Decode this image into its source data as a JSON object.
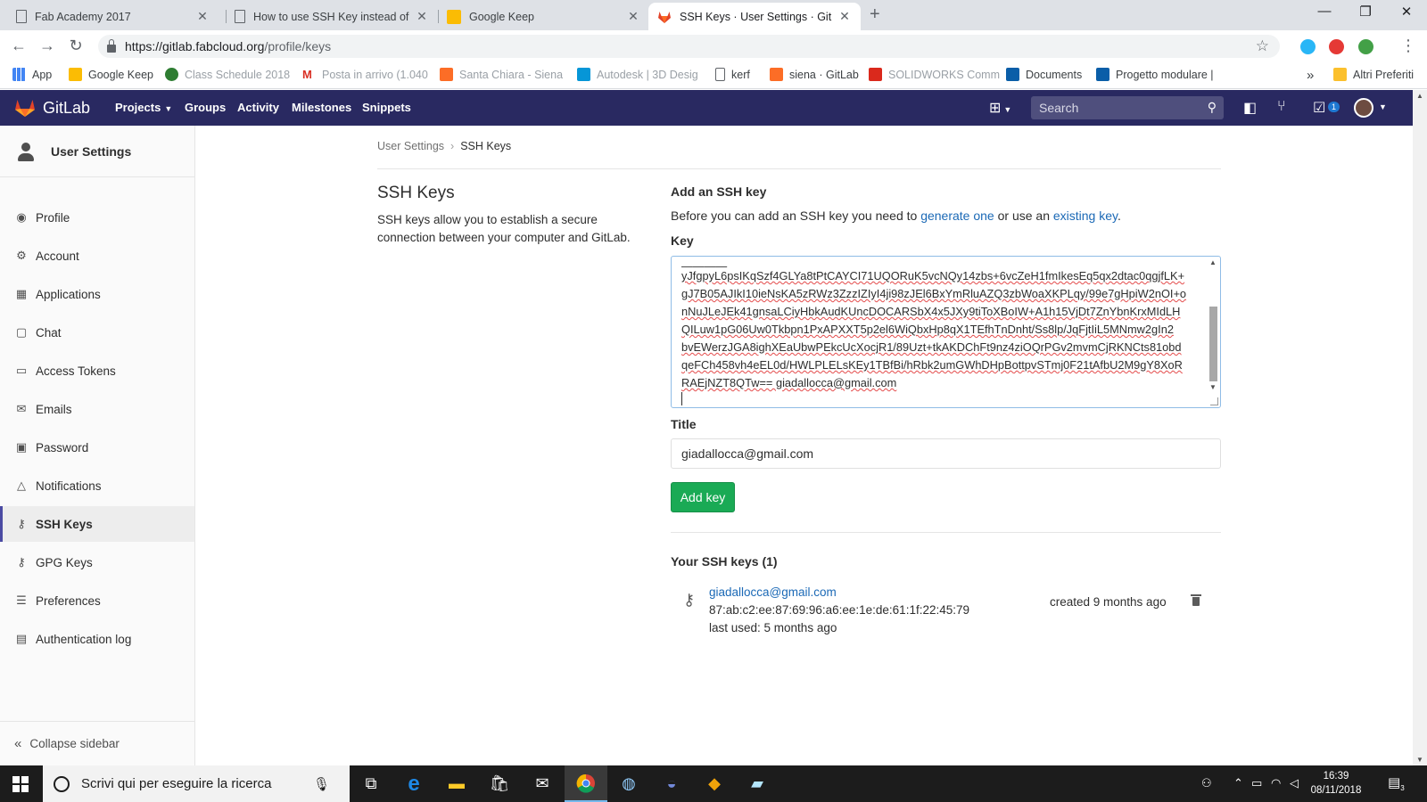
{
  "browser": {
    "tabs": [
      {
        "label": "Fab Academy 2017",
        "icon": "document-icon",
        "active": false
      },
      {
        "label": "How to use SSH Key instead of H",
        "icon": "document-icon",
        "active": false
      },
      {
        "label": "Google Keep",
        "icon": "keep-icon",
        "active": false
      },
      {
        "label": "SSH Keys · User Settings · GitLab",
        "icon": "gitlab-icon",
        "active": true
      }
    ],
    "new_tab": "+",
    "window_controls": {
      "minimize": "—",
      "restore": "❐",
      "close": "✕"
    },
    "url_host": "https://gitlab.fabcloud.org",
    "url_path": "/profile/keys",
    "bookmarks": [
      {
        "label": "App",
        "icon": "apps-icon"
      },
      {
        "label": "Google Keep",
        "icon": "keep-icon"
      },
      {
        "label": "Class Schedule 2018",
        "icon": "globe-icon"
      },
      {
        "label": "Posta in arrivo (1.040",
        "icon": "gmail-icon"
      },
      {
        "label": "Santa Chiara - Siena",
        "icon": "gitlab-icon"
      },
      {
        "label": "Autodesk | 3D Desig",
        "icon": "autodesk-icon"
      },
      {
        "label": "kerf",
        "icon": "document-icon"
      },
      {
        "label": "siena · GitLab",
        "icon": "gitlab-icon"
      },
      {
        "label": "SOLIDWORKS Comm",
        "icon": "solidworks-icon"
      },
      {
        "label": "Documents",
        "icon": "onshape-icon"
      },
      {
        "label": "Progetto modulare |",
        "icon": "onshape-icon"
      }
    ],
    "bookmarks_more": "»",
    "other_bookmarks": "Altri Preferiti"
  },
  "gitlab_nav": {
    "brand": "GitLab",
    "links": [
      "Projects",
      "Groups",
      "Activity",
      "Milestones",
      "Snippets"
    ],
    "search_placeholder": "Search",
    "todo_count": "1",
    "colors": {
      "nav_bg": "#292961",
      "brand_orange": "#fc6d26"
    }
  },
  "sidebar": {
    "title": "User Settings",
    "items": [
      {
        "label": "Profile",
        "icon": "profile-icon"
      },
      {
        "label": "Account",
        "icon": "account-icon"
      },
      {
        "label": "Applications",
        "icon": "applications-icon"
      },
      {
        "label": "Chat",
        "icon": "chat-icon"
      },
      {
        "label": "Access Tokens",
        "icon": "token-icon"
      },
      {
        "label": "Emails",
        "icon": "email-icon"
      },
      {
        "label": "Password",
        "icon": "lock-icon"
      },
      {
        "label": "Notifications",
        "icon": "bell-icon"
      },
      {
        "label": "SSH Keys",
        "icon": "key-icon",
        "active": true
      },
      {
        "label": "GPG Keys",
        "icon": "key-icon"
      },
      {
        "label": "Preferences",
        "icon": "sliders-icon"
      },
      {
        "label": "Authentication log",
        "icon": "log-icon"
      }
    ],
    "collapse_label": "Collapse sidebar"
  },
  "main": {
    "breadcrumb": {
      "parent": "User Settings",
      "current": "SSH Keys"
    },
    "section_title": "SSH Keys",
    "section_desc": "SSH keys allow you to establish a secure connection between your computer and GitLab.",
    "add_title": "Add an SSH key",
    "add_desc_pre": "Before you can add an SSH key you need to ",
    "add_desc_link1": "generate one",
    "add_desc_mid": " or use an ",
    "add_desc_link2": "existing key",
    "add_desc_post": ".",
    "key_label": "Key",
    "key_lines": [
      "yJfgpyL6psIKqSzf4GLYa8tPtCAYCI71UQORuK5vcNQy14zbs+6vcZeH1fmIkesEq5qx2dtac0qgjfLK+",
      "gJ7B05AJIkI10ieNsKA5zRWz3ZzzIZIyI4ji98zJEl6BxYmRluAZQ3zbWoaXKPLqy/99e7gHpiW2nOI+o",
      "nNuJLeJEk41gnsaLCiyHbkAudKUncDOCARSbX4x5JXy9tiToXBoIW+A1h15VjDt7ZnYbnKrxMIdLH",
      "QILuw1pG06Uw0Tkbpn1PxAPXXT5p2el6WiQbxHp8qX1TEfhTnDnht/Ss8lp/JqFjtIiL5MNmw2gIn2",
      "bvEWerzJGA8ighXEaUbwPEkcUcXocjR1/89Uzt+tkAKDChFt9nz4ziOQrPGv2mvmCjRKNCts81obd",
      "qeFCh458vh4eEL0d/HWLPLELsKEy1TBfBi/hRbk2umGWhDHpBottpvSTmj0F21tAfbU2M9gY8XoR",
      "RAEjNZT8QTw== giadallocca@gmail.com"
    ],
    "title_label": "Title",
    "title_value": "giadallocca@gmail.com",
    "add_button": "Add key",
    "your_keys_title": "Your SSH keys (1)",
    "keys": [
      {
        "name": "giadallocca@gmail.com",
        "fingerprint": "87:ab:c2:ee:87:69:96:a6:ee:1e:de:61:1f:22:45:79",
        "last_used": "last used: 5 months ago",
        "created": "created 9 months ago"
      }
    ]
  },
  "taskbar": {
    "search_placeholder": "Scrivi qui per eseguire la ricerca",
    "apps": [
      "task-view-icon",
      "edge-icon",
      "file-explorer-icon",
      "store-icon",
      "mail-icon",
      "chrome-icon",
      "app-icon",
      "discord-icon",
      "git-icon",
      "notes-icon"
    ],
    "time": "16:39",
    "date": "08/11/2018",
    "notifications": "3"
  }
}
